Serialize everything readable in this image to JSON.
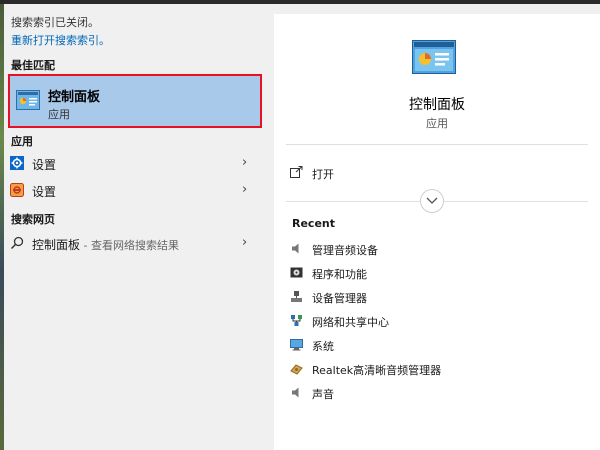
{
  "left": {
    "notice": "搜索索引已关闭。",
    "relink": "重新打开搜索索引。",
    "best_header": "最佳匹配",
    "best": {
      "title": "控制面板",
      "subtitle": "应用"
    },
    "apps_header": "应用",
    "apps": [
      {
        "label": "设置",
        "icon": "settings-gear-icon"
      },
      {
        "label": "设置",
        "icon": "settings-alt-icon"
      }
    ],
    "web_header": "搜索网页",
    "web": {
      "label": "控制面板",
      "hint": " - 查看网络搜索结果",
      "icon": "search-icon"
    }
  },
  "right": {
    "title": "控制面板",
    "subtitle": "应用",
    "open_label": "打开",
    "recent_header": "Recent",
    "recent": [
      {
        "label": "管理音频设备",
        "icon": "speaker-icon"
      },
      {
        "label": "程序和功能",
        "icon": "programs-icon"
      },
      {
        "label": "设备管理器",
        "icon": "device-manager-icon"
      },
      {
        "label": "网络和共享中心",
        "icon": "network-icon"
      },
      {
        "label": "系统",
        "icon": "system-icon"
      },
      {
        "label": "Realtek高清晰音频管理器",
        "icon": "realtek-icon"
      },
      {
        "label": "声音",
        "icon": "sound-icon"
      }
    ]
  },
  "colors": {
    "highlight": "#a8c9ea",
    "highlight_border": "#e81123",
    "link": "#0067b8"
  }
}
